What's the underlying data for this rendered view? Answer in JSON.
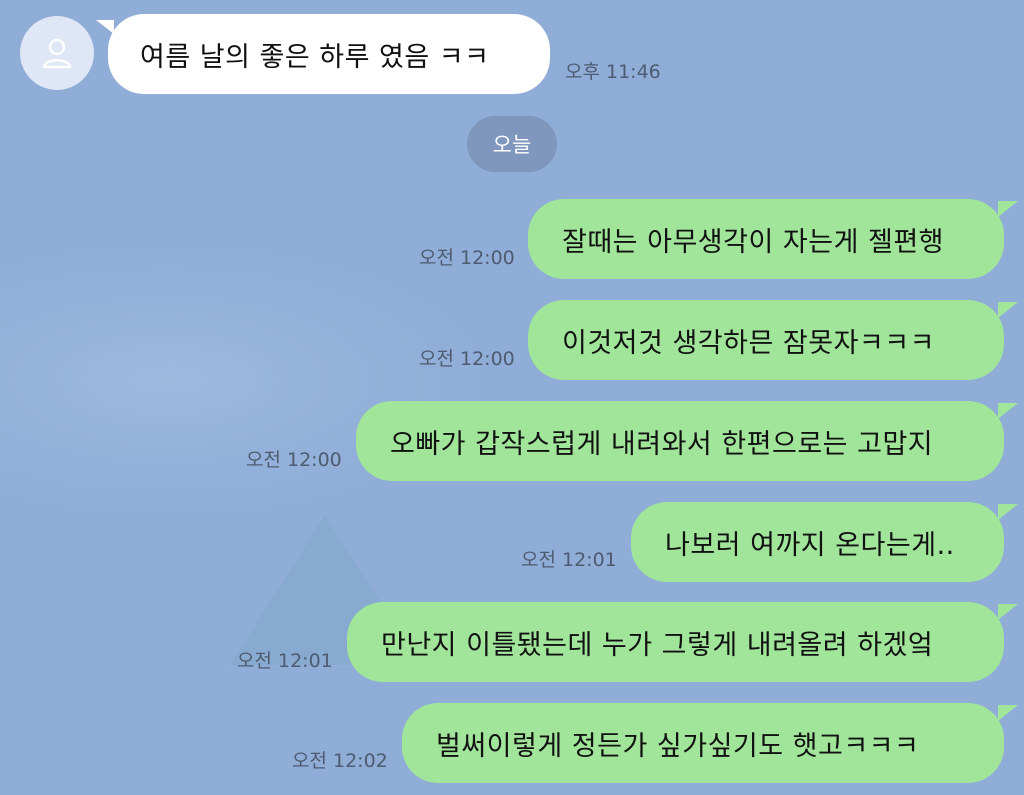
{
  "chat": {
    "incoming": {
      "text": "여름 날의 좋은 하루 였음 ㅋㅋ",
      "time": "오후 11:46"
    },
    "date_separator": "오늘",
    "outgoing": [
      {
        "text": "잘때는 아무생각이 자는게 젤편행",
        "time": "오전 12:00"
      },
      {
        "text": "이것저것 생각하믄 잠못자ㅋㅋㅋ",
        "time": "오전 12:00"
      },
      {
        "text": "오빠가 갑작스럽게 내려와서 한편으로는 고맙지",
        "time": "오전 12:00"
      },
      {
        "text": "나보러 여까지 온다는게..",
        "time": "오전 12:01"
      },
      {
        "text": "만난지 이틀됐는데 누가 그렇게 내려올려 하겠엌",
        "time": "오전 12:01"
      },
      {
        "text": "벌써이렇게 정든가 싶가싶기도 햇고ㅋㅋㅋ",
        "time": "오전 12:02"
      }
    ]
  },
  "icons": {
    "avatar": "person-icon"
  },
  "colors": {
    "background": "#8fadd7",
    "incoming_bubble": "#ffffff",
    "outgoing_bubble": "#a1e59a",
    "date_separator": "#7f97bd"
  }
}
